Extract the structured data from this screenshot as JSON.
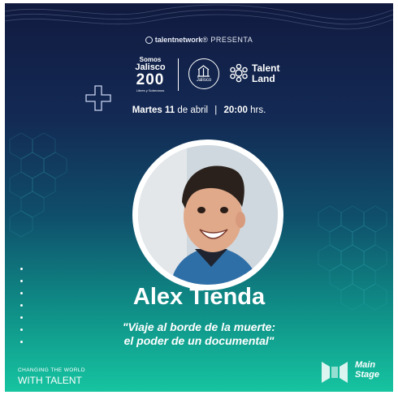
{
  "header": {
    "brand": "talentnetwork",
    "brand_mark": "®",
    "presents": "PRESENTA"
  },
  "logos": {
    "jalisco_line1": "Somos",
    "jalisco_line2": "Jalisco",
    "jalisco_line3": "200",
    "jalisco_line4": "Libres y Soberanos",
    "seal_label": "Jalisco",
    "talent_land_line1": "Talent",
    "talent_land_line2": "Land"
  },
  "event": {
    "day": "Martes 11",
    "date_rest": "de abril",
    "separator": "|",
    "time": "20:00",
    "time_unit": "hrs."
  },
  "speaker": {
    "name": "Alex Tienda"
  },
  "talk": {
    "title_line1": "\"Viaje al borde de la muerte:",
    "title_line2": "el poder de un documental\""
  },
  "footer": {
    "slogan_line1": "CHANGING THE WORLD",
    "slogan_line2": "WITH TALENT",
    "stage_line1": "Main",
    "stage_line2": "Stage"
  },
  "colors": {
    "top": "#111a3f",
    "bottom": "#16c4a0",
    "accent_text": "#ffffff"
  },
  "icons": [
    "talentnetwork-icon",
    "plus-cross-icon",
    "talent-land-icon",
    "jalisco-seal-icon",
    "main-stage-icon"
  ]
}
